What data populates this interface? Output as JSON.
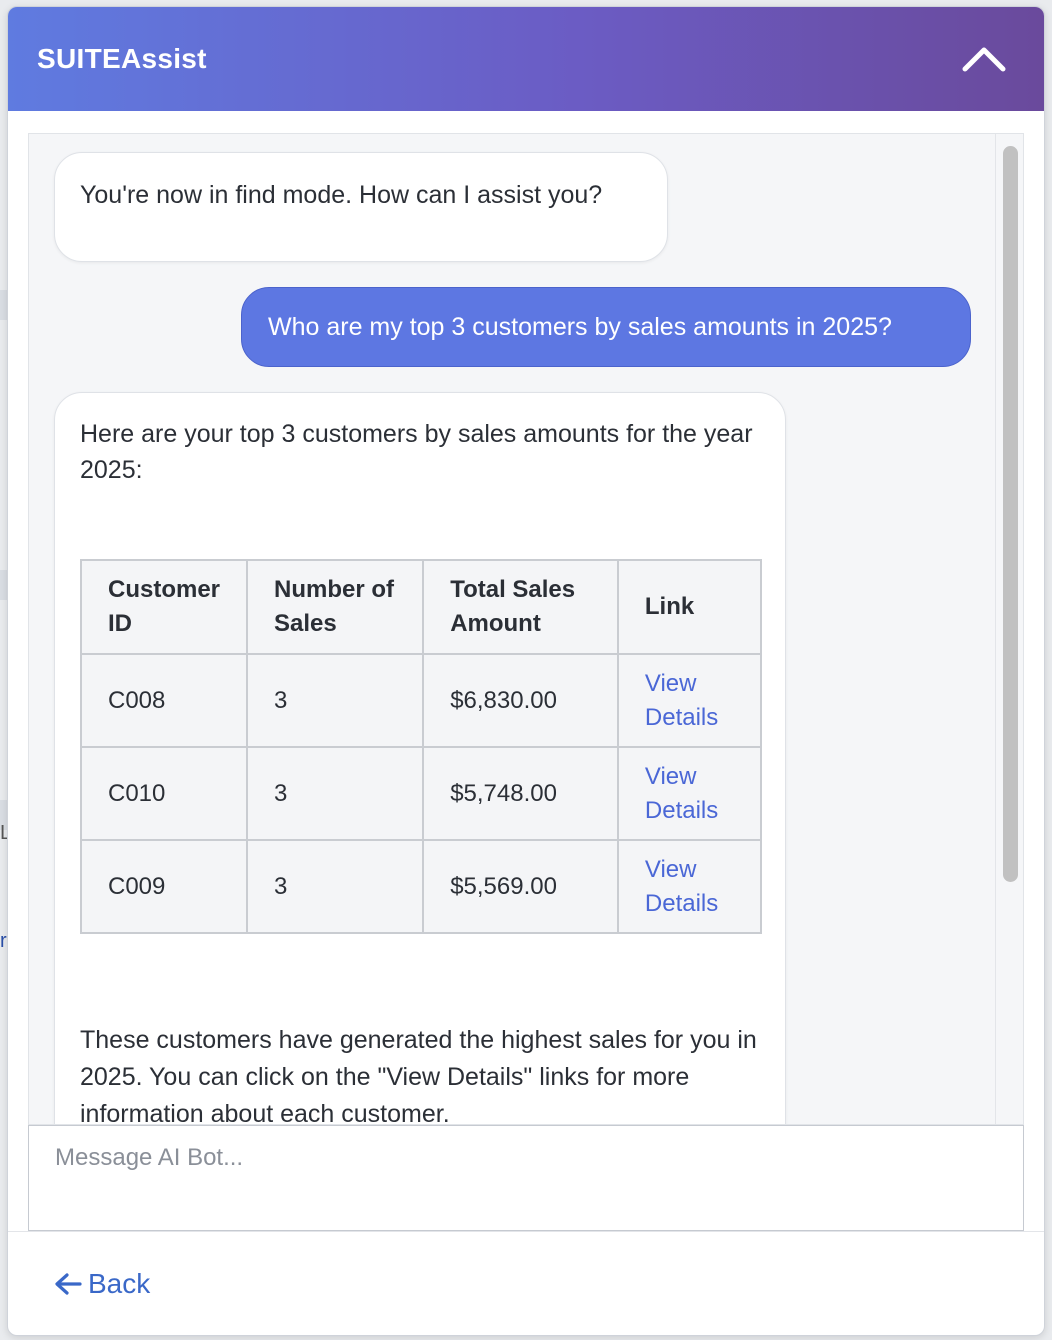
{
  "header": {
    "title": "SUITEAssist"
  },
  "messages": {
    "bot_greeting": "You're now in find mode. How can I assist you?",
    "user_query": "Who are my top 3 customers by sales amounts in 2025?",
    "bot_intro": "Here are your top 3 customers by sales amounts for the year 2025:",
    "bot_outro": "These customers have generated the highest sales for you in 2025. You can click on the \"View Details\" links for more information about each customer."
  },
  "table": {
    "headers": [
      "Customer ID",
      "Number of Sales",
      "Total Sales Amount",
      "Link"
    ],
    "rows": [
      {
        "customer_id": "C008",
        "num_sales": "3",
        "total": "$6,830.00",
        "link": "View Details"
      },
      {
        "customer_id": "C010",
        "num_sales": "3",
        "total": "$5,748.00",
        "link": "View Details"
      },
      {
        "customer_id": "C009",
        "num_sales": "3",
        "total": "$5,569.00",
        "link": "View Details"
      }
    ]
  },
  "input": {
    "placeholder": "Message AI Bot...",
    "value": ""
  },
  "footer": {
    "back_label": "Back"
  },
  "background": {
    "char1": "L",
    "char2": "r"
  },
  "icons": {
    "collapse": "chevron-up-icon",
    "back": "arrow-left-icon"
  },
  "colors": {
    "accent": "#5d77e2",
    "link": "#4a67d6",
    "back_link": "#3a68c8"
  }
}
